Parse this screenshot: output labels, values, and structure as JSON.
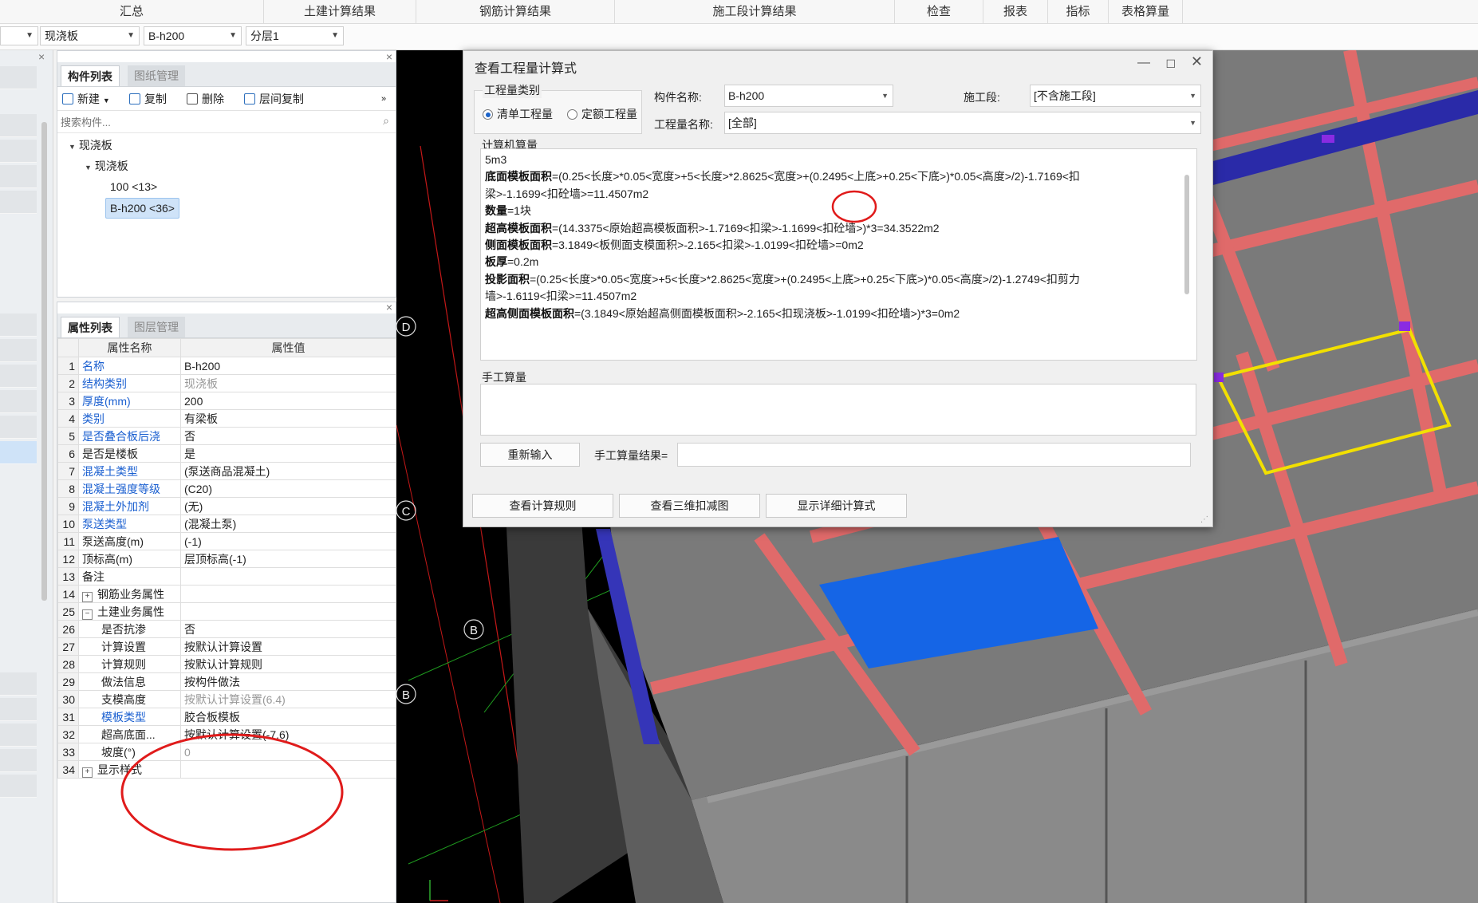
{
  "top_menu": [
    "汇总",
    "土建计算结果",
    "钢筋计算结果",
    "施工段计算结果",
    "检查",
    "报表",
    "指标",
    "表格算量"
  ],
  "toolbar_selects": [
    "现浇板",
    "B-h200",
    "分层1"
  ],
  "component_panel": {
    "tabs": [
      "构件列表",
      "图纸管理"
    ],
    "buttons": {
      "new": "新建",
      "copy": "复制",
      "delete": "删除",
      "floor_copy": "层间复制"
    },
    "search_placeholder": "搜索构件...",
    "tree": {
      "root": "现浇板",
      "child": "现浇板",
      "items": [
        "100 <13>",
        "B-h200 <36>"
      ]
    }
  },
  "property_panel": {
    "tabs": [
      "属性列表",
      "图层管理"
    ],
    "headers": [
      "属性名称",
      "属性值"
    ],
    "rows": [
      {
        "n": "1",
        "name": "名称",
        "value": "B-h200",
        "blue": true
      },
      {
        "n": "2",
        "name": "结构类别",
        "value": "现浇板",
        "blue": true,
        "gray": true
      },
      {
        "n": "3",
        "name": "厚度(mm)",
        "value": "200",
        "blue": true
      },
      {
        "n": "4",
        "name": "类别",
        "value": "有梁板",
        "blue": true
      },
      {
        "n": "5",
        "name": "是否叠合板后浇",
        "value": "否",
        "blue": true
      },
      {
        "n": "6",
        "name": "是否是楼板",
        "value": "是"
      },
      {
        "n": "7",
        "name": "混凝土类型",
        "value": "(泵送商品混凝土)",
        "blue": true
      },
      {
        "n": "8",
        "name": "混凝土强度等级",
        "value": "(C20)",
        "blue": true
      },
      {
        "n": "9",
        "name": "混凝土外加剂",
        "value": "(无)",
        "blue": true
      },
      {
        "n": "10",
        "name": "泵送类型",
        "value": "(混凝土泵)",
        "blue": true
      },
      {
        "n": "11",
        "name": "泵送高度(m)",
        "value": "(-1)"
      },
      {
        "n": "12",
        "name": "顶标高(m)",
        "value": "层顶标高(-1)"
      },
      {
        "n": "13",
        "name": "备注",
        "value": ""
      },
      {
        "n": "14",
        "name": "钢筋业务属性",
        "value": "",
        "exp": "+"
      },
      {
        "n": "25",
        "name": "土建业务属性",
        "value": "",
        "exp": "−"
      },
      {
        "n": "26",
        "name": "是否抗渗",
        "value": "否",
        "indent": true
      },
      {
        "n": "27",
        "name": "计算设置",
        "value": "按默认计算设置",
        "indent": true
      },
      {
        "n": "28",
        "name": "计算规则",
        "value": "按默认计算规则",
        "indent": true
      },
      {
        "n": "29",
        "name": "做法信息",
        "value": "按构件做法",
        "indent": true
      },
      {
        "n": "30",
        "name": "支模高度",
        "value": "按默认计算设置(6.4)",
        "indent": true,
        "gray": true
      },
      {
        "n": "31",
        "name": "模板类型",
        "value": "胶合板模板",
        "indent": true,
        "blue": true
      },
      {
        "n": "32",
        "name": "超高底面...",
        "value": "按默认计算设置(-7.6)",
        "indent": true
      },
      {
        "n": "33",
        "name": "坡度(°)",
        "value": "0",
        "indent": true,
        "gray": true
      },
      {
        "n": "34",
        "name": "显示样式",
        "value": "",
        "exp": "+"
      }
    ]
  },
  "grid_labels": [
    "D",
    "C",
    "B",
    "B"
  ],
  "dialog": {
    "title": "查看工程量计算式",
    "category_title": "工程量类别",
    "radio_list": "清单工程量",
    "radio_quota": "定额工程量",
    "component_label": "构件名称:",
    "component_value": "B-h200",
    "segment_label": "施工段:",
    "segment_value": "[不含施工段]",
    "quantity_label": "工程量名称:",
    "quantity_value": "[全部]",
    "computer_title": "计算机算量",
    "calc_lines": [
      {
        "label": "",
        "text": "5m3"
      },
      {
        "label": "底面模板面积",
        "text": "=(0.25<长度>*0.05<宽度>+5<长度>*2.8625<宽度>+(0.2495<上底>+0.25<下底>)*0.05<高度>/2)-1.7169<扣"
      },
      {
        "label": "",
        "text": "梁>-1.1699<扣砼墙>=11.4507m2"
      },
      {
        "label": "数量",
        "text": "=1块"
      },
      {
        "label": "超高模板面积",
        "text": "=(14.3375<原始超高模板面积>-1.7169<扣梁>-1.1699<扣砼墙>)*3=34.3522m2"
      },
      {
        "label": "侧面模板面积",
        "text": "=3.1849<板侧面支模面积>-2.165<扣梁>-1.0199<扣砼墙>=0m2"
      },
      {
        "label": "板厚",
        "text": "=0.2m"
      },
      {
        "label": "投影面积",
        "text": "=(0.25<长度>*0.05<宽度>+5<长度>*2.8625<宽度>+(0.2495<上底>+0.25<下底>)*0.05<高度>/2)-1.2749<扣剪力"
      },
      {
        "label": "",
        "text": "墙>-1.6119<扣梁>=11.4507m2"
      },
      {
        "label": "超高侧面模板面积",
        "text": "=(3.1849<原始超高侧面模板面积>-2.165<扣现浇板>-1.0199<扣砼墙>)*3=0m2"
      }
    ],
    "manual_title": "手工算量",
    "reinput": "重新输入",
    "manual_result_label": "手工算量结果=",
    "view_rules": "查看计算规则",
    "view_3d": "查看三维扣减图",
    "show_detail": "显示详细计算式"
  }
}
